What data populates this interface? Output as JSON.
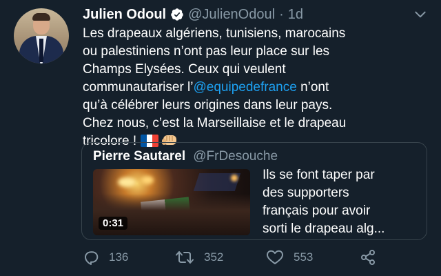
{
  "author": {
    "name": "Julien Odoul",
    "handle": "@JulienOdoul",
    "separator": "·",
    "time": "1d",
    "verified": true,
    "avatar": "avatar-portrait"
  },
  "tweet": {
    "lines": [
      {
        "text": "Les drapeaux algériens, tunisiens, marocains"
      },
      {
        "text": "ou palestiniens n’ont pas leur place sur les"
      },
      {
        "text": "Champs Elysées. Ceux qui veulent"
      },
      {
        "before": "communautariser l’",
        "mention": "@equipedefrance",
        "after": " n’ont"
      },
      {
        "text": "qu’à célébrer leurs origines dans leur pays."
      },
      {
        "text": "Chez nous, c’est la Marseillaise et le drapeau"
      },
      {
        "text": "tricolore !"
      }
    ],
    "emojis": [
      "flag-france-icon",
      "fist-icon"
    ]
  },
  "quoted": {
    "name": "Pierre Sautarel",
    "handle": "@FrDesouche",
    "media": {
      "type": "video",
      "duration": "0:31"
    },
    "lines": [
      "Ils se font taper par",
      "des supporters",
      "français pour avoir",
      "sorti le drapeau alg..."
    ]
  },
  "actions": {
    "reply": {
      "icon": "reply-icon",
      "count": "136"
    },
    "retweet": {
      "icon": "retweet-icon",
      "count": "352"
    },
    "like": {
      "icon": "heart-icon",
      "count": "553"
    },
    "share": {
      "icon": "share-icon"
    }
  },
  "colors": {
    "background": "#15202b",
    "text": "#ffffff",
    "secondary": "#8899a6",
    "link": "#1da1f2",
    "border": "#38444d"
  }
}
